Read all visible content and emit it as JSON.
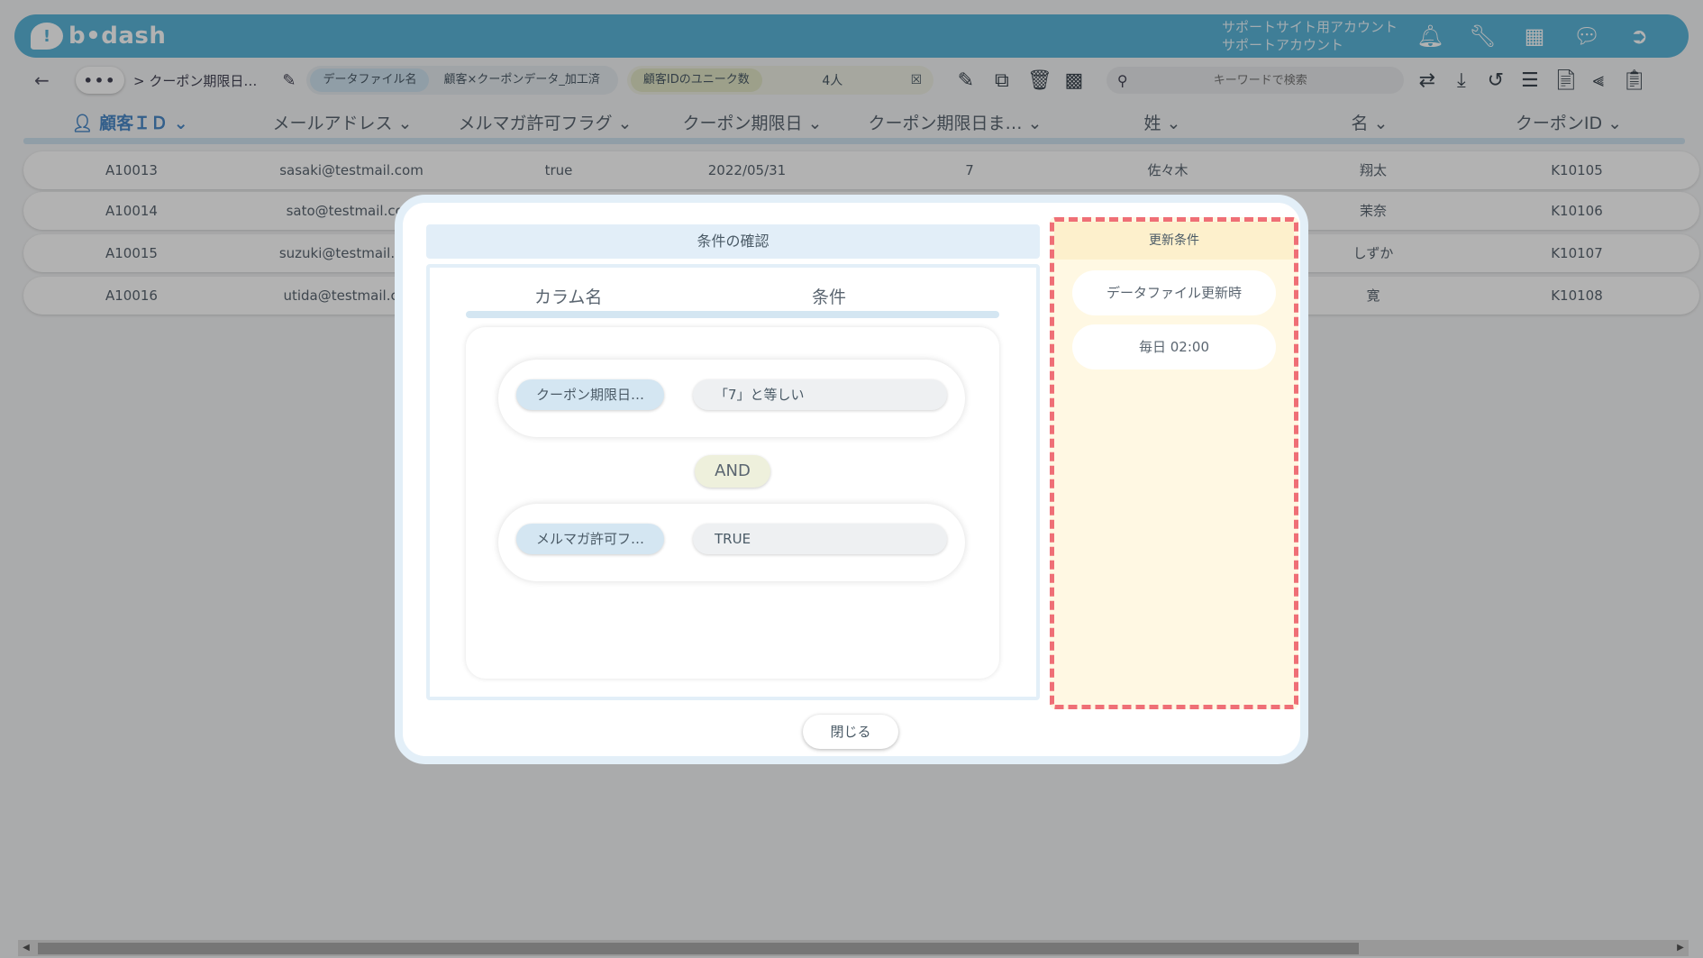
{
  "header": {
    "logo_text": "b•dash",
    "account_line1": "サポートサイト用アカウント",
    "account_line2": "サポートアカウント"
  },
  "toolbar": {
    "breadcrumb": "> クーポン期限日…",
    "datafile_label": "データファイル名",
    "datafile_value": "顧客×クーポンデータ_加工済",
    "unique_label": "顧客IDのユニーク数",
    "unique_value": "4人",
    "search_placeholder": "キーワードで検索"
  },
  "table": {
    "headers": [
      "顧客ＩＤ",
      "メールアドレス",
      "メルマガ許可フラグ",
      "クーポン期限日",
      "クーポン期限日ま…",
      "姓",
      "名",
      "クーポンID"
    ],
    "rows": [
      [
        "A10013",
        "sasaki@testmail.com",
        "true",
        "2022/05/31",
        "7",
        "佐々木",
        "翔太",
        "K10105"
      ],
      [
        "A10014",
        "sato@testmail.com",
        "",
        "",
        "",
        "",
        "茉奈",
        "K10106"
      ],
      [
        "A10015",
        "suzuki@testmail.com",
        "",
        "",
        "",
        "",
        "しずか",
        "K10107"
      ],
      [
        "A10016",
        "utida@testmail.com",
        "",
        "",
        "",
        "",
        "寛",
        "K10108"
      ]
    ]
  },
  "modal": {
    "title": "条件の確認",
    "column_header": "カラム名",
    "condition_header": "条件",
    "rules": [
      {
        "column": "クーポン期限日…",
        "condition": "「7」と等しい"
      },
      {
        "column": "メルマガ許可フ…",
        "condition": "TRUE"
      }
    ],
    "operator": "AND",
    "update_title": "更新条件",
    "update_items": [
      "データファイル更新時",
      "毎日 02:00"
    ],
    "close_label": "閉じる"
  },
  "colors": {
    "header_bg": "#5bb5d9",
    "accent_blue": "#4a89c8",
    "highlight_dash": "#ef6f76",
    "update_bg": "#fff8e3"
  }
}
